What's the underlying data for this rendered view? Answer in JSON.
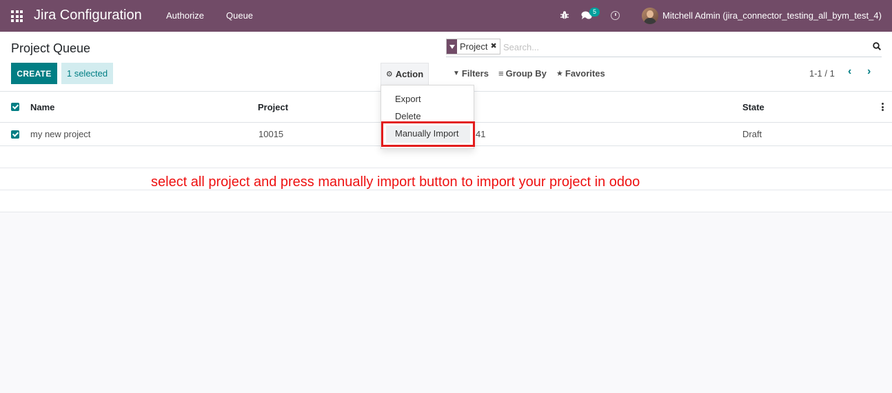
{
  "navbar": {
    "app_title": "Jira Configuration",
    "menu": [
      "Authorize",
      "Queue"
    ],
    "message_count": "5",
    "user": "Mitchell Admin (jira_connector_testing_all_bym_test_4)"
  },
  "control_panel": {
    "breadcrumb": "Project Queue",
    "create_label": "CREATE",
    "selected_label": "1 selected",
    "action_label": "Action",
    "search": {
      "facet_label": "Project",
      "placeholder": "Search..."
    },
    "filters_label": "Filters",
    "group_by_label": "Group By",
    "favorites_label": "Favorites",
    "pager": "1-1 / 1"
  },
  "action_menu": {
    "items": [
      "Export",
      "Delete",
      "Manually Import"
    ]
  },
  "list": {
    "columns": [
      "Name",
      "Project",
      "State"
    ],
    "rows": [
      {
        "name": "my new project",
        "project": "10015",
        "partial": "41",
        "state": "Draft"
      }
    ]
  },
  "annotation": "select all project and press manually import button to import your project in odoo",
  "colors": {
    "navbar": "#714b67",
    "primary": "#017e84",
    "highlight": "#e31c1c"
  }
}
